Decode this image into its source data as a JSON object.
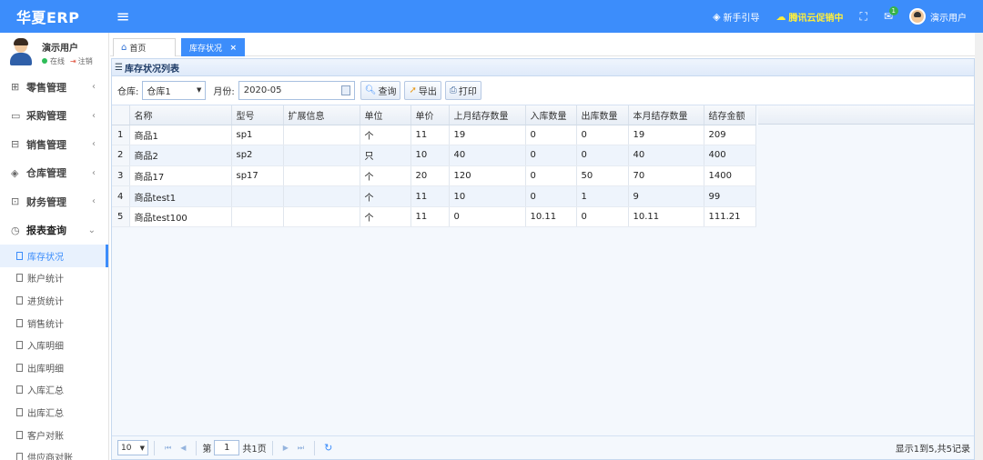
{
  "app": {
    "title": "华夏ERP"
  },
  "topbar": {
    "guide": "新手引导",
    "promo": "腾讯云促销中",
    "mail_badge": "1",
    "user": "演示用户"
  },
  "sidebar": {
    "user_name": "演示用户",
    "status_online": "在线",
    "logout": "注销",
    "groups": [
      {
        "label": "零售管理",
        "icon": "gift-icon"
      },
      {
        "label": "采购管理",
        "icon": "monitor-icon"
      },
      {
        "label": "销售管理",
        "icon": "briefcase-icon"
      },
      {
        "label": "仓库管理",
        "icon": "layers-icon"
      },
      {
        "label": "财务管理",
        "icon": "book-icon"
      },
      {
        "label": "报表查询",
        "icon": "clock-icon"
      }
    ],
    "items": [
      "库存状况",
      "账户统计",
      "进货统计",
      "销售统计",
      "入库明细",
      "出库明细",
      "入库汇总",
      "出库汇总",
      "客户对账",
      "供应商对账"
    ]
  },
  "tabs": {
    "home": "首页",
    "active": "库存状况"
  },
  "panel": {
    "title": "库存状况列表"
  },
  "toolbar": {
    "warehouse_label": "仓库:",
    "warehouse_value": "仓库1",
    "month_label": "月份:",
    "month_value": "2020-05",
    "query": "查询",
    "export": "导出",
    "print": "打印"
  },
  "table": {
    "columns": [
      "名称",
      "型号",
      "扩展信息",
      "单位",
      "单价",
      "上月结存数量",
      "入库数量",
      "出库数量",
      "本月结存数量",
      "结存金额"
    ],
    "rows": [
      [
        "1",
        "商品1",
        "sp1",
        "",
        "个",
        "11",
        "19",
        "0",
        "0",
        "19",
        "209"
      ],
      [
        "2",
        "商品2",
        "sp2",
        "",
        "只",
        "10",
        "40",
        "0",
        "0",
        "40",
        "400"
      ],
      [
        "3",
        "商品17",
        "sp17",
        "",
        "个",
        "20",
        "120",
        "0",
        "50",
        "70",
        "1400"
      ],
      [
        "4",
        "商品test1",
        "",
        "",
        "个",
        "11",
        "10",
        "0",
        "1",
        "9",
        "99"
      ],
      [
        "5",
        "商品test100",
        "",
        "",
        "个",
        "11",
        "0",
        "10.11",
        "0",
        "10.11",
        "111.21"
      ]
    ]
  },
  "pager": {
    "page_size": "10",
    "page_prefix": "第",
    "page": "1",
    "page_suffix": "共1页",
    "info": "显示1到5,共5记录"
  },
  "colors": {
    "primary": "#3c8dfb",
    "promo": "#ffef3b"
  }
}
